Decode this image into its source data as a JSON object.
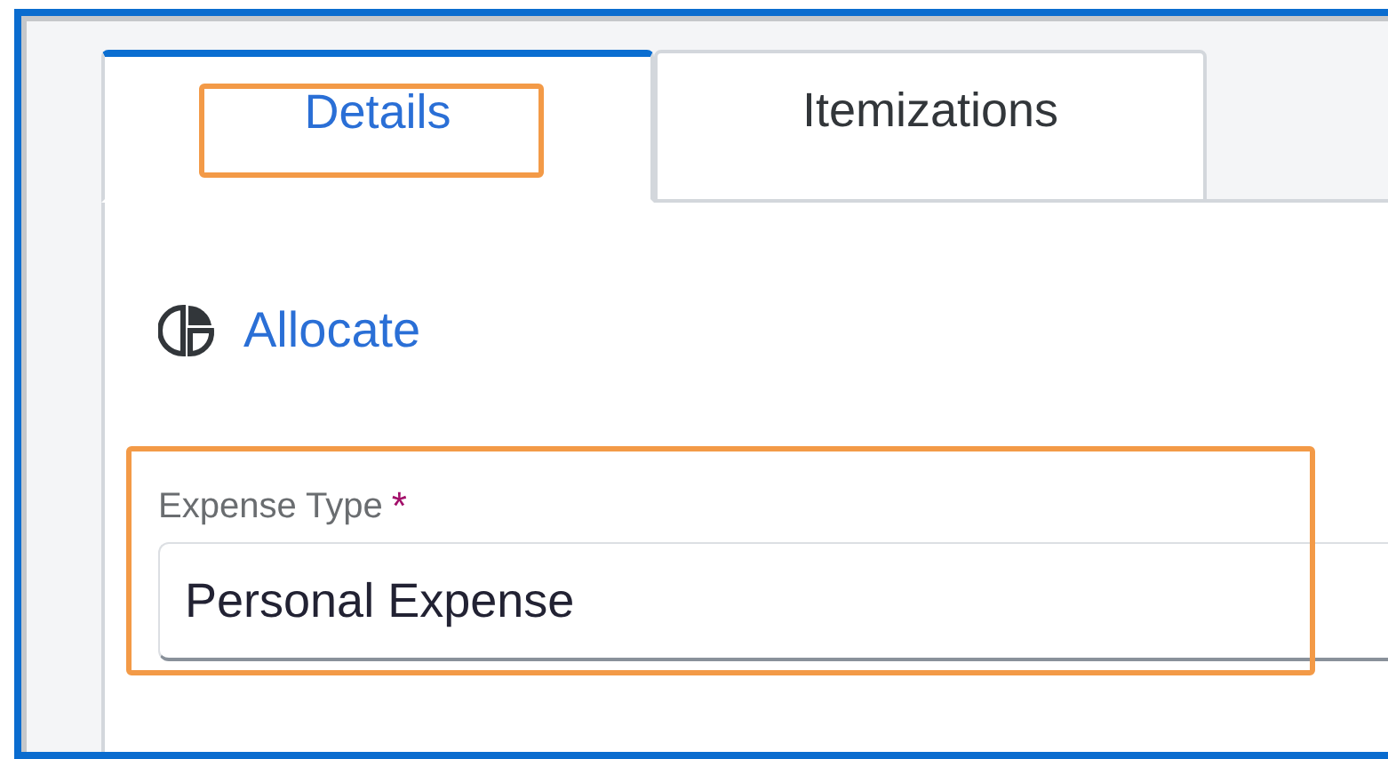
{
  "tabs": [
    {
      "label": "Details",
      "selected": true,
      "highlighted": true
    },
    {
      "label": "Itemizations",
      "selected": false,
      "highlighted": false
    }
  ],
  "allocate": {
    "label": "Allocate"
  },
  "expense_type": {
    "label": "Expense Type",
    "required": true,
    "required_mark": "*",
    "value": "Personal Expense",
    "highlighted": true
  }
}
